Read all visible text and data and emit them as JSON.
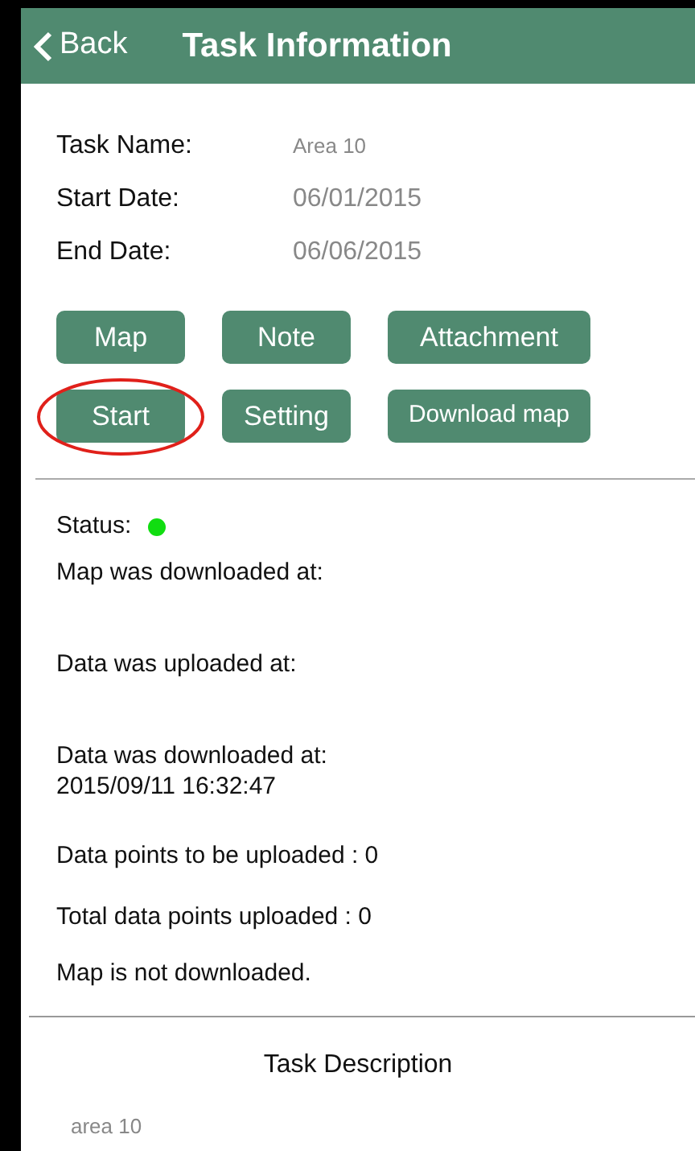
{
  "header": {
    "back": "Back",
    "title": "Task Information"
  },
  "fields": [
    {
      "label": "Task Name:",
      "value": "Area 10",
      "small": true
    },
    {
      "label": "Start Date:",
      "value": "06/01/2015",
      "small": false
    },
    {
      "label": "End Date:",
      "value": "06/06/2015",
      "small": false
    }
  ],
  "buttons": [
    {
      "label": "Map",
      "circled": false
    },
    {
      "label": "Note",
      "circled": false
    },
    {
      "label": "Attachment",
      "circled": false
    },
    {
      "label": "Start",
      "circled": true
    },
    {
      "label": "Setting",
      "circled": false
    },
    {
      "label": "Download map",
      "circled": false
    }
  ],
  "status": {
    "label": "Status:",
    "color": "#11dd11"
  },
  "info": [
    {
      "kind": "timestamp",
      "label": "Map was downloaded at:"
    },
    {
      "kind": "timestamp",
      "label": "Data was uploaded at:"
    },
    {
      "kind": "timestamp",
      "label": "Data was downloaded at:",
      "value": "2015/09/11 16:32:47"
    },
    {
      "kind": "line",
      "label": "Data points to be uploaded : 0"
    },
    {
      "kind": "line",
      "label": "Total data points uploaded : 0"
    },
    {
      "kind": "line",
      "label": "Map is not downloaded."
    }
  ],
  "description": {
    "heading": "Task Description",
    "text": "area 10"
  }
}
